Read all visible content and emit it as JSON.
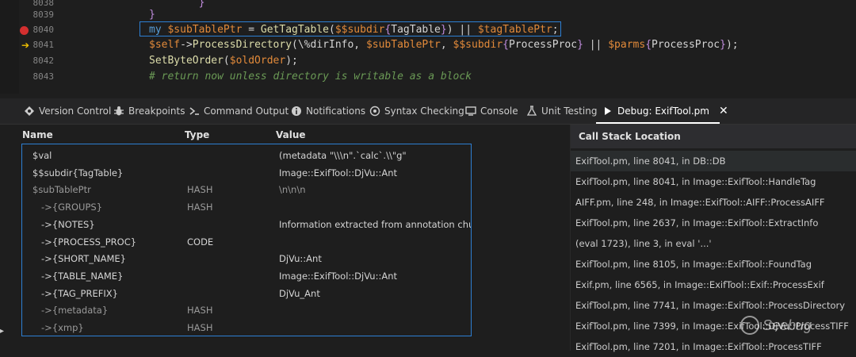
{
  "editor": {
    "lines": [
      {
        "no": "8038",
        "parts": [
          {
            "c": "t-brace",
            "t": "        }"
          }
        ]
      },
      {
        "no": "8039",
        "parts": [
          {
            "c": "t-brace",
            "t": "}"
          }
        ]
      },
      {
        "no": "8040",
        "parts": [
          {
            "c": "t-kw",
            "t": "my "
          },
          {
            "c": "t-var",
            "t": "$subTablePtr"
          },
          {
            "c": "t-plain",
            "t": " = "
          },
          {
            "c": "t-fn",
            "t": "GetTagTable"
          },
          {
            "c": "t-plain",
            "t": "("
          },
          {
            "c": "t-var",
            "t": "$$subdir"
          },
          {
            "c": "t-brace",
            "t": "{"
          },
          {
            "c": "t-plain",
            "t": "TagTable"
          },
          {
            "c": "t-brace",
            "t": "}"
          },
          {
            "c": "t-plain",
            "t": ") || "
          },
          {
            "c": "t-var",
            "t": "$tagTablePtr"
          },
          {
            "c": "t-plain",
            "t": ";"
          }
        ]
      },
      {
        "no": "8041",
        "parts": [
          {
            "c": "t-var",
            "t": "$self"
          },
          {
            "c": "t-plain",
            "t": "->"
          },
          {
            "c": "t-fn",
            "t": "ProcessDirectory"
          },
          {
            "c": "t-plain",
            "t": "(\\%dirInfo, "
          },
          {
            "c": "t-var",
            "t": "$subTablePtr"
          },
          {
            "c": "t-plain",
            "t": ", "
          },
          {
            "c": "t-var",
            "t": "$$subdir"
          },
          {
            "c": "t-brace",
            "t": "{"
          },
          {
            "c": "t-plain",
            "t": "ProcessProc"
          },
          {
            "c": "t-brace",
            "t": "}"
          },
          {
            "c": "t-plain",
            "t": " || "
          },
          {
            "c": "t-var",
            "t": "$parms"
          },
          {
            "c": "t-brace",
            "t": "{"
          },
          {
            "c": "t-plain",
            "t": "ProcessProc"
          },
          {
            "c": "t-brace",
            "t": "}"
          },
          {
            "c": "t-plain",
            "t": ");"
          }
        ]
      },
      {
        "no": "8042",
        "parts": [
          {
            "c": "t-fn",
            "t": "SetByteOrder"
          },
          {
            "c": "t-plain",
            "t": "("
          },
          {
            "c": "t-var",
            "t": "$oldOrder"
          },
          {
            "c": "t-plain",
            "t": ");"
          }
        ]
      },
      {
        "no": "8043",
        "parts": [
          {
            "c": "t-comment",
            "t": "# return now unless directory is writable as a block"
          }
        ]
      }
    ]
  },
  "tabs": [
    {
      "label": "Version Control",
      "icon": "version-control-icon"
    },
    {
      "label": "Breakpoints",
      "icon": "bug-icon"
    },
    {
      "label": "Command Output",
      "icon": "terminal-icon"
    },
    {
      "label": "Notifications",
      "icon": "info-icon"
    },
    {
      "label": "Syntax Checking",
      "icon": "syntax-check-icon"
    },
    {
      "label": "Console",
      "icon": "console-icon"
    },
    {
      "label": "Unit Testing",
      "icon": "flask-icon"
    },
    {
      "label": "Debug: ExifTool.pm",
      "icon": "play-icon"
    }
  ],
  "variables": {
    "headers": {
      "name": "Name",
      "type": "Type",
      "value": "Value"
    },
    "rows": [
      {
        "name": "$val",
        "type": "",
        "value": "(metadata \"\\\\\\n\".`calc`.\\\\\"g\"",
        "indent": 0,
        "dim": false
      },
      {
        "name": "$$subdir{TagTable}",
        "type": "",
        "value": "Image::ExifTool::DjVu::Ant",
        "indent": 0,
        "dim": false
      },
      {
        "name": "$subTablePtr",
        "type": "HASH",
        "value": "\\n\\n\\n",
        "indent": 0,
        "dim": true
      },
      {
        "name": "->{GROUPS}",
        "type": "HASH",
        "value": "",
        "indent": 1,
        "dim": true
      },
      {
        "name": "->{NOTES}",
        "type": "",
        "value": "Information extracted from annotation chunks.",
        "indent": 1,
        "dim": false
      },
      {
        "name": "->{PROCESS_PROC}",
        "type": "CODE",
        "value": "",
        "indent": 1,
        "dim": false
      },
      {
        "name": "->{SHORT_NAME}",
        "type": "",
        "value": "DjVu::Ant",
        "indent": 1,
        "dim": false
      },
      {
        "name": "->{TABLE_NAME}",
        "type": "",
        "value": "Image::ExifTool::DjVu::Ant",
        "indent": 1,
        "dim": false
      },
      {
        "name": "->{TAG_PREFIX}",
        "type": "",
        "value": "DjVu_Ant",
        "indent": 1,
        "dim": false
      },
      {
        "name": "->{metadata}",
        "type": "HASH",
        "value": "",
        "indent": 1,
        "dim": true
      },
      {
        "name": "->{xmp}",
        "type": "HASH",
        "value": "",
        "indent": 1,
        "dim": true
      }
    ]
  },
  "call_stack": {
    "title": "Call Stack Location",
    "rows": [
      "ExifTool.pm, line 8041, in DB::DB",
      "ExifTool.pm, line 8041, in Image::ExifTool::HandleTag",
      "AIFF.pm, line 248, in Image::ExifTool::AIFF::ProcessAIFF",
      "ExifTool.pm, line 2637, in Image::ExifTool::ExtractInfo",
      "(eval 1723), line 3, in eval '...'",
      "ExifTool.pm, line 8105, in Image::ExifTool::FoundTag",
      "Exif.pm, line 6565, in Image::ExifTool::Exif::ProcessExif",
      "ExifTool.pm, line 7741, in Image::ExifTool::ProcessDirectory",
      "ExifTool.pm, line 7399, in Image::ExifTool::DjVu::ProcessTIFF",
      "ExifTool.pm, line 7201, in Image::ExifTool::ProcessTIFF"
    ]
  },
  "watermark": "Seebug",
  "colors": {
    "accent": "#2d7fd3",
    "breakpoint": "#d32f2f",
    "variable": "#e28a3a"
  }
}
